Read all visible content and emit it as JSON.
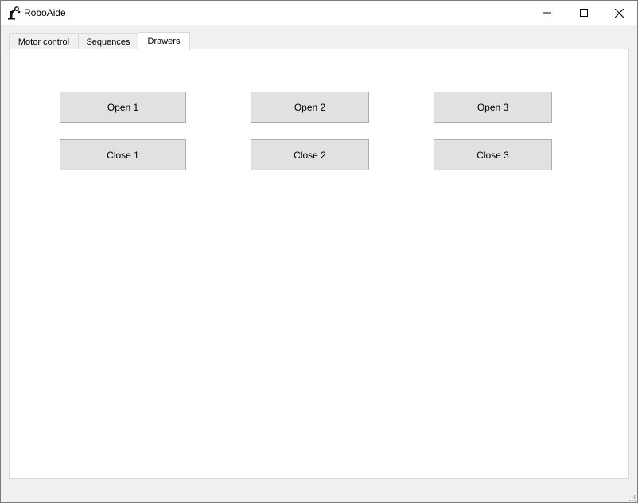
{
  "window": {
    "title": "RoboAide",
    "icons": {
      "app": "robot-arm-icon",
      "minimize": "minimize-icon",
      "maximize": "maximize-icon",
      "close": "close-icon"
    }
  },
  "tabs": [
    {
      "label": "Motor control",
      "active": false
    },
    {
      "label": "Sequences",
      "active": false
    },
    {
      "label": "Drawers",
      "active": true
    }
  ],
  "drawers": {
    "buttons": [
      {
        "label": "Open 1"
      },
      {
        "label": "Open 2"
      },
      {
        "label": "Open 3"
      },
      {
        "label": "Close 1"
      },
      {
        "label": "Close 2"
      },
      {
        "label": "Close 3"
      }
    ]
  },
  "colors": {
    "button_bg": "#e1e1e1",
    "button_border": "#adadad",
    "panel_bg": "#ffffff",
    "window_bg": "#f0f0f0"
  }
}
